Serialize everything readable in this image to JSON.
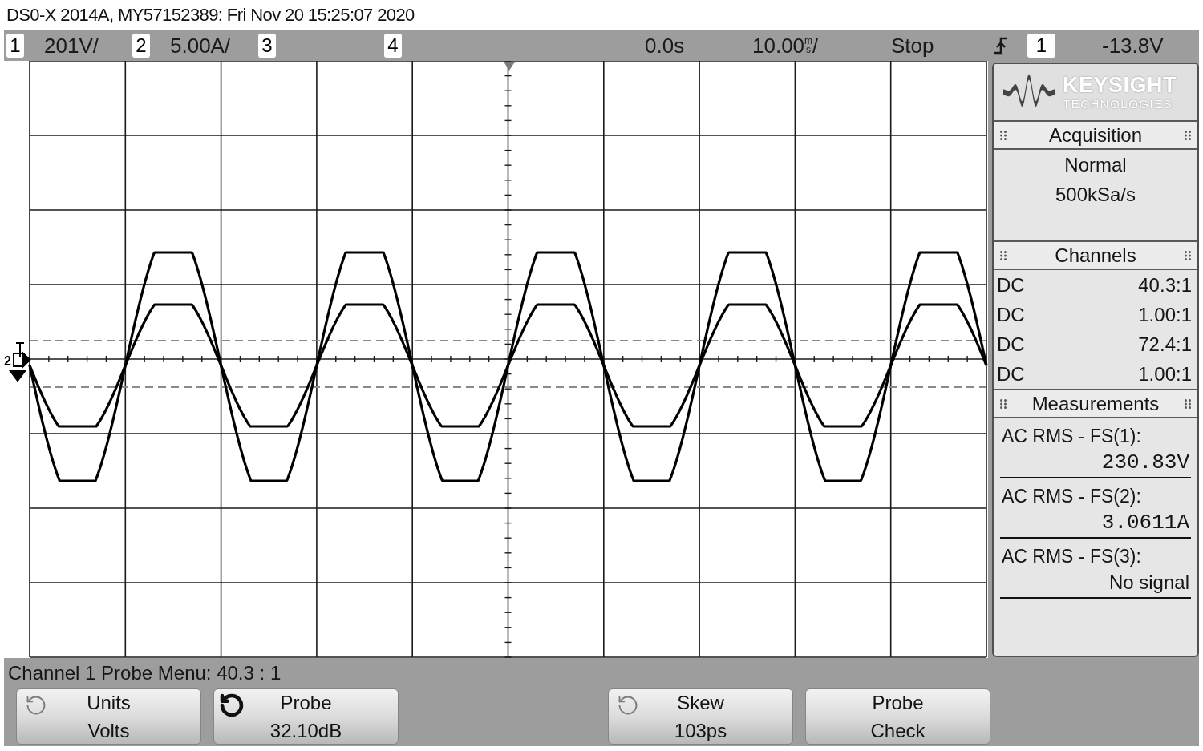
{
  "title": "DS0-X 2014A, MY57152389: Fri Nov 20 15:25:07 2020",
  "status_bar": {
    "channels": [
      {
        "number": "1",
        "scale": "201V/"
      },
      {
        "number": "2",
        "scale": "5.00A/"
      },
      {
        "number": "3"
      },
      {
        "number": "4"
      }
    ],
    "delay": "0.0s",
    "timebase": {
      "value": "10.00",
      "unit_upper": "m",
      "unit_lower": "s",
      "suffix": "/"
    },
    "run_state": "Stop",
    "trigger": {
      "source": "1",
      "level": "-13.8V"
    }
  },
  "display": {
    "marker_label": "2"
  },
  "side_panel": {
    "logo": {
      "name": "KEYSIGHT",
      "tagline": "TECHNOLOGIES"
    },
    "acquisition": {
      "title": "Acquisition",
      "mode": "Normal",
      "sample_rate": "500kSa/s"
    },
    "channels": {
      "title": "Channels",
      "rows": [
        {
          "coupling": "DC",
          "probe": "40.3:1"
        },
        {
          "coupling": "DC",
          "probe": "1.00:1"
        },
        {
          "coupling": "DC",
          "probe": "72.4:1"
        },
        {
          "coupling": "DC",
          "probe": "1.00:1"
        }
      ]
    },
    "measurements": {
      "title": "Measurements",
      "items": [
        {
          "kind": "reading",
          "label": "AC RMS - FS(1):",
          "value": "230.83V"
        },
        {
          "kind": "reading",
          "label": "AC RMS - FS(2):",
          "value": "3.0611A"
        },
        {
          "kind": "notice",
          "label": "AC RMS - FS(3):",
          "value": "No signal"
        }
      ]
    }
  },
  "softkey_menu": {
    "title": "Channel 1 Probe Menu: 40.3 : 1",
    "softkeys": [
      {
        "kind": "key",
        "top": "Units",
        "bottom": "Volts",
        "knob": true,
        "knob_active": false
      },
      {
        "kind": "key",
        "top": "Probe",
        "bottom": "32.10dB",
        "knob": true,
        "knob_active": true
      },
      {
        "kind": "empty"
      },
      {
        "kind": "key",
        "top": "Skew",
        "bottom": "103ps",
        "knob": true,
        "knob_active": false
      },
      {
        "kind": "key",
        "top": "Probe",
        "bottom": "Check",
        "knob": false,
        "knob_active": false
      },
      {
        "kind": "empty"
      }
    ]
  }
}
